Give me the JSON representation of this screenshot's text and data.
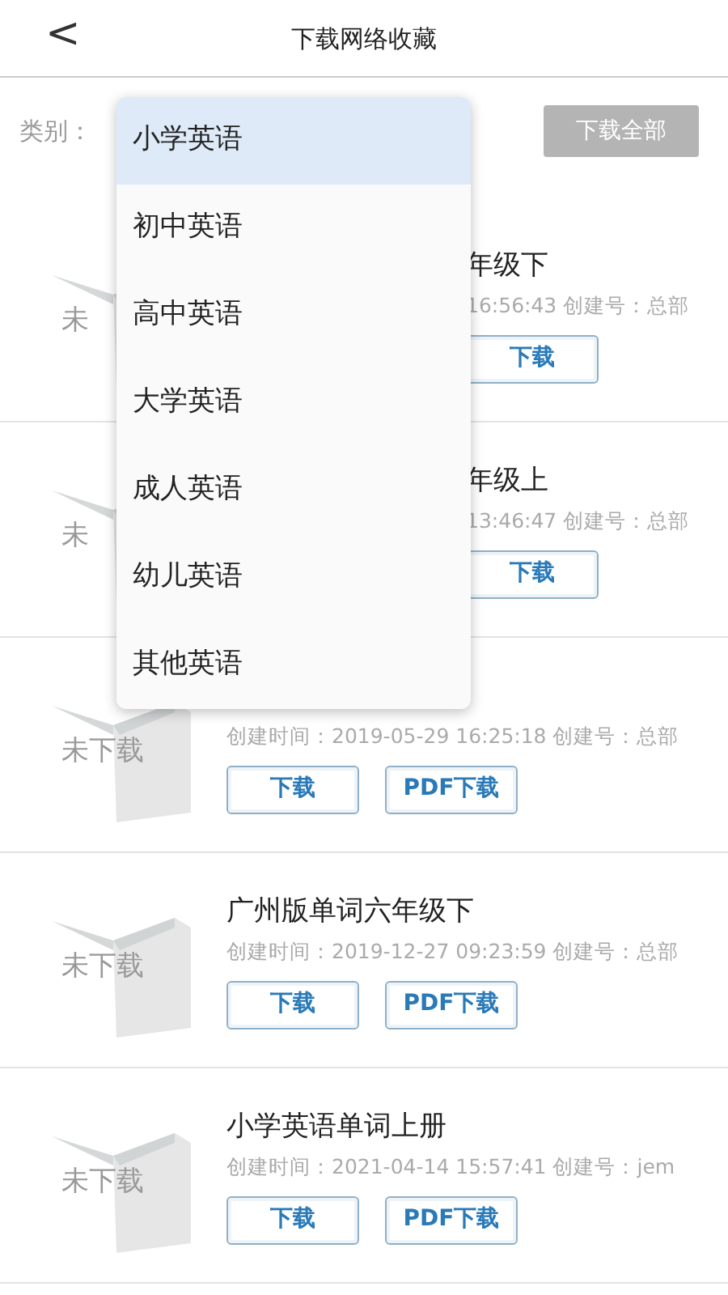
{
  "header": {
    "back": "<",
    "title": "下载网络收藏"
  },
  "filter": {
    "label": "类别：",
    "download_all": "下载全部"
  },
  "category_menu": [
    {
      "label": "小学英语",
      "selected": true
    },
    {
      "label": "初中英语",
      "selected": false
    },
    {
      "label": "高中英语",
      "selected": false
    },
    {
      "label": "大学英语",
      "selected": false
    },
    {
      "label": "成人英语",
      "selected": false
    },
    {
      "label": "幼儿英语",
      "selected": false
    },
    {
      "label": "其他英语",
      "selected": false
    }
  ],
  "items": [
    {
      "covered": true,
      "status": "未",
      "title": "年级下",
      "meta": "16:56:43 创建号：总部",
      "buttons": [
        "下载"
      ]
    },
    {
      "covered": true,
      "status": "未",
      "title": "年级上",
      "meta": "13:46:47 创建号：总部",
      "buttons": [
        "下载"
      ]
    },
    {
      "covered": false,
      "status": "未下载",
      "meta": "创建时间：2019-05-29 16:25:18 创建号：总部",
      "buttons": [
        "下载",
        "PDF下载"
      ]
    },
    {
      "covered": false,
      "status": "未下载",
      "title": "广州版单词六年级下",
      "meta": "创建时间：2019-12-27 09:23:59 创建号：总部",
      "buttons": [
        "下载",
        "PDF下载"
      ]
    },
    {
      "covered": false,
      "status": "未下载",
      "title": "小学英语单词上册",
      "meta": "创建时间：2021-04-14 15:57:41 创建号：jem",
      "buttons": [
        "下载",
        "PDF下载"
      ]
    }
  ]
}
